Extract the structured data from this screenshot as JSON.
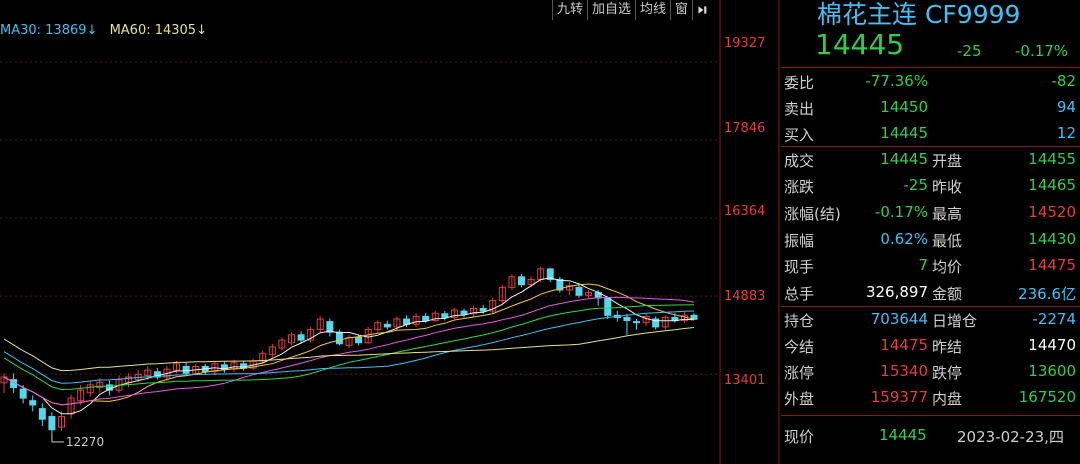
{
  "ma_legend": {
    "ma30": "MA30: 13869↓",
    "ma60": "MA60: 14305↓"
  },
  "toolbar": {
    "btn1": "九转",
    "btn2": "加自选",
    "btn3": "均线",
    "btn4": "窗"
  },
  "price_axis": [
    "19327",
    "17846",
    "16364",
    "14883",
    "13401"
  ],
  "low_marker": "12270",
  "colors": {
    "up": "#e63b3b",
    "down": "#2ed04a",
    "accent": "#3fc1f5"
  },
  "quote": {
    "title": "棉花主连 CF9999",
    "price": "14445",
    "change": "-25",
    "change_pct": "-0.17%"
  },
  "rows": [
    {
      "l1": "委比",
      "v1": "-77.36%",
      "v1c": "g",
      "v2": "-82",
      "v2c": "g"
    },
    {
      "l1": "卖出",
      "v1": "14450",
      "v1c": "g",
      "v2": "94",
      "v2c": "c"
    },
    {
      "l1": "买入",
      "v1": "14445",
      "v1c": "g",
      "v2": "12",
      "v2c": "c"
    },
    {
      "l1": "成交",
      "v1": "14445",
      "v1c": "g",
      "l2": "开盘",
      "v2": "14455",
      "v2c": "g"
    },
    {
      "l1": "涨跌",
      "v1": "-25",
      "v1c": "g",
      "l2": "昨收",
      "v2": "14465",
      "v2c": "g"
    },
    {
      "l1": "涨幅(结)",
      "v1": "-0.17%",
      "v1c": "g",
      "l2": "最高",
      "v2": "14520",
      "v2c": "r"
    },
    {
      "l1": "振幅",
      "v1": "0.62%",
      "v1c": "c",
      "l2": "最低",
      "v2": "14430",
      "v2c": "g"
    },
    {
      "l1": "现手",
      "v1": "7",
      "v1c": "g",
      "l2": "均价",
      "v2": "14475",
      "v2c": "r"
    },
    {
      "l1": "总手",
      "v1": "326,897",
      "v1c": "w",
      "l2": "金额",
      "v2": "236.6亿",
      "v2c": "c"
    },
    {
      "l1": "持仓",
      "v1": "703644",
      "v1c": "c",
      "l2": "日增仓",
      "v2": "-2274",
      "v2c": "c"
    },
    {
      "l1": "今结",
      "v1": "14475",
      "v1c": "r",
      "l2": "昨结",
      "v2": "14470",
      "v2c": "w"
    },
    {
      "l1": "涨停",
      "v1": "15340",
      "v1c": "r",
      "l2": "跌停",
      "v2": "13600",
      "v2c": "g"
    },
    {
      "l1": "外盘",
      "v1": "159377",
      "v1c": "r",
      "l2": "内盘",
      "v2": "167520",
      "v2c": "g"
    }
  ],
  "bottom": {
    "label": "现价",
    "price": "14445",
    "date": "2023-02-23,四"
  },
  "chart_data": {
    "type": "candlestick",
    "y_axis_labels": [
      19327,
      17846,
      16364,
      14883,
      13401
    ],
    "ylim": [
      11700,
      20500
    ],
    "low_annotation": 12270,
    "ma_values": {
      "MA30": 13869,
      "MA60": 14305
    },
    "candles": [
      [
        13240,
        13350,
        13050,
        13420
      ],
      [
        13300,
        13150,
        13050,
        13420
      ],
      [
        13120,
        12950,
        12850,
        13200
      ],
      [
        12900,
        12820,
        12700,
        13000
      ],
      [
        12750,
        12550,
        12420,
        12850
      ],
      [
        12600,
        12350,
        12270,
        12680
      ],
      [
        12400,
        12600,
        12330,
        12700
      ],
      [
        12650,
        12950,
        12560,
        13020
      ],
      [
        12900,
        13100,
        12820,
        13200
      ],
      [
        13050,
        13200,
        12980,
        13280
      ],
      [
        13150,
        13250,
        13050,
        13330
      ],
      [
        13200,
        13100,
        13000,
        13280
      ],
      [
        13100,
        13300,
        13050,
        13380
      ],
      [
        13250,
        13350,
        13150,
        13420
      ],
      [
        13300,
        13400,
        13250,
        13480
      ],
      [
        13380,
        13480,
        13300,
        13550
      ],
      [
        13450,
        13350,
        13300,
        13520
      ],
      [
        13350,
        13500,
        13280,
        13560
      ],
      [
        13480,
        13600,
        13420,
        13650
      ],
      [
        13550,
        13420,
        13380,
        13620
      ],
      [
        13420,
        13550,
        13380,
        13600
      ],
      [
        13550,
        13450,
        13400,
        13600
      ],
      [
        13450,
        13600,
        13380,
        13650
      ],
      [
        13580,
        13500,
        13430,
        13650
      ],
      [
        13500,
        13620,
        13450,
        13680
      ],
      [
        13600,
        13520,
        13470,
        13660
      ],
      [
        13520,
        13650,
        13480,
        13700
      ],
      [
        13650,
        13800,
        13600,
        13850
      ],
      [
        13780,
        13920,
        13720,
        13980
      ],
      [
        13900,
        14050,
        13850,
        14100
      ],
      [
        14000,
        14150,
        13950,
        14200
      ],
      [
        14150,
        14050,
        13980,
        14220
      ],
      [
        14050,
        14250,
        14000,
        14300
      ],
      [
        14250,
        14450,
        14200,
        14500
      ],
      [
        14400,
        14200,
        14120,
        14460
      ],
      [
        14200,
        13980,
        13950,
        14250
      ],
      [
        13950,
        14100,
        13900,
        14150
      ],
      [
        14100,
        14000,
        13950,
        14150
      ],
      [
        14000,
        14250,
        13980,
        14300
      ],
      [
        14250,
        14380,
        14200,
        14420
      ],
      [
        14350,
        14300,
        14250,
        14420
      ],
      [
        14300,
        14450,
        14250,
        14500
      ],
      [
        14450,
        14350,
        14300,
        14520
      ],
      [
        14350,
        14500,
        14300,
        14560
      ],
      [
        14500,
        14420,
        14380,
        14560
      ],
      [
        14420,
        14560,
        14400,
        14600
      ],
      [
        14550,
        14480,
        14420,
        14600
      ],
      [
        14480,
        14620,
        14450,
        14660
      ],
      [
        14600,
        14540,
        14480,
        14650
      ],
      [
        14550,
        14650,
        14500,
        14700
      ],
      [
        14650,
        14600,
        14550,
        14720
      ],
      [
        14600,
        14800,
        14560,
        14850
      ],
      [
        14800,
        15050,
        14750,
        15100
      ],
      [
        15050,
        15250,
        15000,
        15300
      ],
      [
        15250,
        15100,
        15050,
        15300
      ],
      [
        15100,
        15200,
        15050,
        15260
      ],
      [
        15200,
        15400,
        15150,
        15450
      ],
      [
        15400,
        15200,
        15150,
        15420
      ],
      [
        15200,
        15000,
        14950,
        15250
      ],
      [
        15000,
        15080,
        14900,
        15150
      ],
      [
        15050,
        14900,
        14850,
        15100
      ],
      [
        14900,
        14950,
        14850,
        15000
      ],
      [
        14950,
        14850,
        14700,
        15000
      ],
      [
        14850,
        14520,
        14450,
        14880
      ],
      [
        14520,
        14480,
        14400,
        14600
      ],
      [
        14480,
        14420,
        14150,
        14550
      ],
      [
        14400,
        14380,
        14250,
        14450
      ],
      [
        14380,
        14500,
        14320,
        14560
      ],
      [
        14450,
        14300,
        14250,
        14500
      ],
      [
        14300,
        14480,
        14250,
        14520
      ],
      [
        14480,
        14420,
        14380,
        14560
      ],
      [
        14420,
        14520,
        14380,
        14580
      ],
      [
        14520,
        14445,
        14430,
        14560
      ]
    ]
  }
}
